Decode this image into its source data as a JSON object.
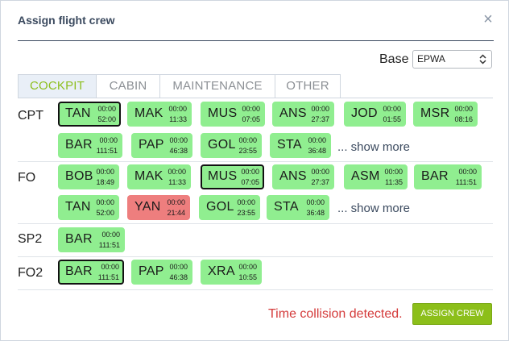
{
  "dialog": {
    "title": "Assign flight crew",
    "close_glyph": "×"
  },
  "base": {
    "label": "Base",
    "value": "EPWA"
  },
  "tabs": [
    {
      "label": "COCKPIT",
      "active": true
    },
    {
      "label": "CABIN",
      "active": false
    },
    {
      "label": "MAINTENANCE",
      "active": false
    },
    {
      "label": "OTHER",
      "active": false
    }
  ],
  "rows": {
    "cpt": {
      "rank": "CPT",
      "chips": [
        {
          "code": "TAN",
          "t1": "00:00",
          "t2": "52:00",
          "state": "selected"
        },
        {
          "code": "MAK",
          "t1": "00:00",
          "t2": "11:33",
          "state": "normal"
        },
        {
          "code": "MUS",
          "t1": "00:00",
          "t2": "07:05",
          "state": "normal"
        },
        {
          "code": "ANS",
          "t1": "00:00",
          "t2": "27:37",
          "state": "normal"
        },
        {
          "code": "JOD",
          "t1": "00:00",
          "t2": "01:55",
          "state": "normal"
        },
        {
          "code": "MSR",
          "t1": "00:00",
          "t2": "08:16",
          "state": "normal"
        },
        {
          "code": "BAR",
          "t1": "00:00",
          "t2": "111:51",
          "state": "normal"
        },
        {
          "code": "PAP",
          "t1": "00:00",
          "t2": "46:38",
          "state": "normal"
        },
        {
          "code": "GOL",
          "t1": "00:00",
          "t2": "23:55",
          "state": "normal"
        },
        {
          "code": "STA",
          "t1": "00:00",
          "t2": "36:48",
          "state": "normal"
        }
      ],
      "show_more": "... show more"
    },
    "fo": {
      "rank": "FO",
      "chips": [
        {
          "code": "BOB",
          "t1": "00:00",
          "t2": "18:49",
          "state": "normal"
        },
        {
          "code": "MAK",
          "t1": "00:00",
          "t2": "11:33",
          "state": "normal"
        },
        {
          "code": "MUS",
          "t1": "00:00",
          "t2": "07:05",
          "state": "selected"
        },
        {
          "code": "ANS",
          "t1": "00:00",
          "t2": "27:37",
          "state": "normal"
        },
        {
          "code": "ASM",
          "t1": "00:00",
          "t2": "11:35",
          "state": "normal"
        },
        {
          "code": "BAR",
          "t1": "00:00",
          "t2": "111:51",
          "state": "normal"
        },
        {
          "code": "TAN",
          "t1": "00:00",
          "t2": "52:00",
          "state": "normal"
        },
        {
          "code": "YAN",
          "t1": "00:00",
          "t2": "21:44",
          "state": "conflict"
        },
        {
          "code": "GOL",
          "t1": "00:00",
          "t2": "23:55",
          "state": "normal"
        },
        {
          "code": "STA",
          "t1": "00:00",
          "t2": "36:48",
          "state": "normal"
        }
      ],
      "show_more": "... show more"
    },
    "sp2": {
      "rank": "SP2",
      "chips": [
        {
          "code": "BAR",
          "t1": "00:00",
          "t2": "111:51",
          "state": "normal"
        }
      ]
    },
    "fo2": {
      "rank": "FO2",
      "chips": [
        {
          "code": "BAR",
          "t1": "00:00",
          "t2": "111:51",
          "state": "selected"
        },
        {
          "code": "PAP",
          "t1": "00:00",
          "t2": "46:38",
          "state": "normal"
        },
        {
          "code": "XRA",
          "t1": "00:00",
          "t2": "10:55",
          "state": "normal"
        }
      ]
    }
  },
  "footer": {
    "collision_message": "Time collision detected.",
    "assign_label": "ASSIGN CREW"
  },
  "colors": {
    "chip_available": "#90ee90",
    "chip_conflict": "#ee7e7e",
    "accent": "#8cbf1a",
    "error_text": "#d43a3a"
  }
}
